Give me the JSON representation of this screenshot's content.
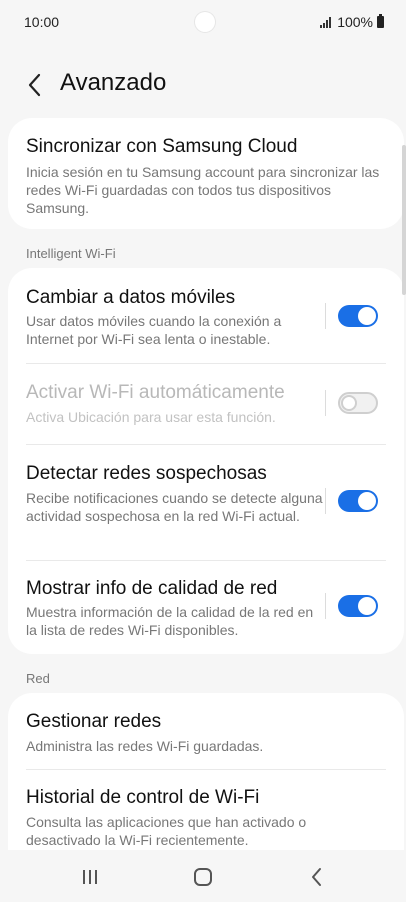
{
  "status_bar": {
    "time": "10:00",
    "battery": "100%"
  },
  "header": {
    "title": "Avanzado",
    "back_icon": "chevron-left-icon"
  },
  "sync": {
    "title": "Sincronizar con Samsung Cloud",
    "subtitle": "Inicia sesión en tu Samsung account para sincronizar las redes Wi-Fi guardadas con todos tus dispositivos Samsung."
  },
  "intelligent_wifi": {
    "label": "Intelligent Wi-Fi",
    "items": [
      {
        "title": "Cambiar a datos móviles",
        "subtitle": "Usar datos móviles cuando la conexión a Internet por Wi-Fi sea lenta o inestable.",
        "enabled": true,
        "on": true
      },
      {
        "title": "Activar Wi-Fi automáticamente",
        "subtitle": "Activa Ubicación para usar esta función.",
        "enabled": false,
        "on": false
      },
      {
        "title": "Detectar redes sospechosas",
        "subtitle": "Recibe notificaciones cuando se detecte alguna actividad sospechosa en la red Wi-Fi actual.",
        "enabled": true,
        "on": true
      },
      {
        "title": "Mostrar info de calidad de red",
        "subtitle": "Muestra información de la calidad de la red en la lista de redes Wi-Fi disponibles.",
        "enabled": true,
        "on": true
      }
    ]
  },
  "red": {
    "label": "Red",
    "items": [
      {
        "title": "Gestionar redes",
        "subtitle": "Administra las redes Wi-Fi guardadas."
      },
      {
        "title": "Historial de control de Wi-Fi",
        "subtitle": "Consulta las aplicaciones que han activado o desactivado la Wi-Fi recientemente."
      }
    ]
  },
  "colors": {
    "accent": "#1a6fe6",
    "background": "#f6f6f6",
    "card": "#ffffff"
  },
  "navbar": {
    "recents_icon": "recents-icon",
    "home_icon": "home-icon",
    "back_icon": "back-icon"
  }
}
